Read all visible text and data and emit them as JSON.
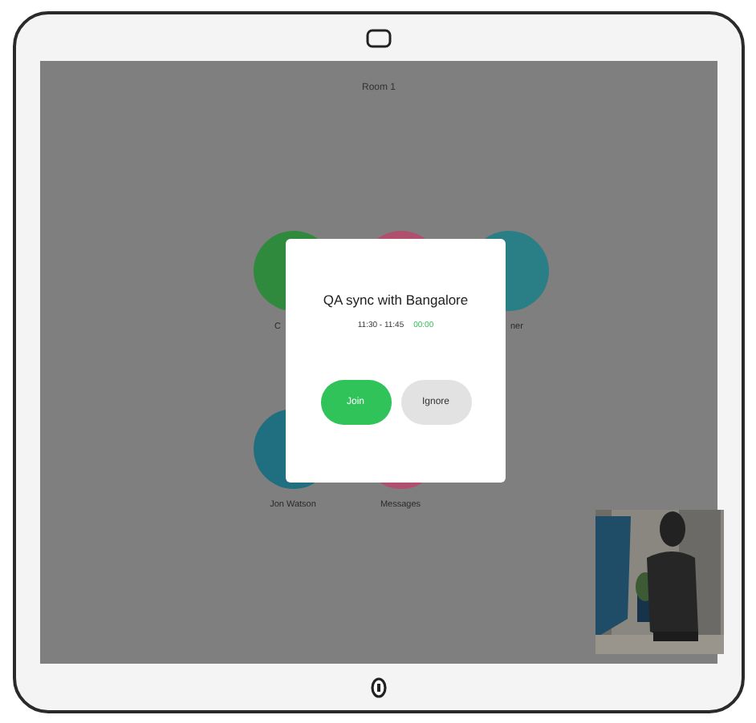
{
  "header": {
    "title": "Room 1"
  },
  "tiles": [
    {
      "label": "C",
      "color": "#2f8a3e"
    },
    {
      "color": "#b0506e"
    },
    {
      "label": "ner",
      "color": "#2a7f86"
    },
    {
      "label": "Jon Watson",
      "color": "#1f6f80"
    },
    {
      "label": "Messages",
      "color": "#b0506e"
    }
  ],
  "dialog": {
    "title": "QA sync with Bangalore",
    "time": "11:30 - 11:45",
    "countdown": "00:00",
    "buttons": [
      {
        "label": "Join",
        "kind": "primary"
      },
      {
        "label": "Ignore",
        "kind": "secondary"
      }
    ]
  }
}
